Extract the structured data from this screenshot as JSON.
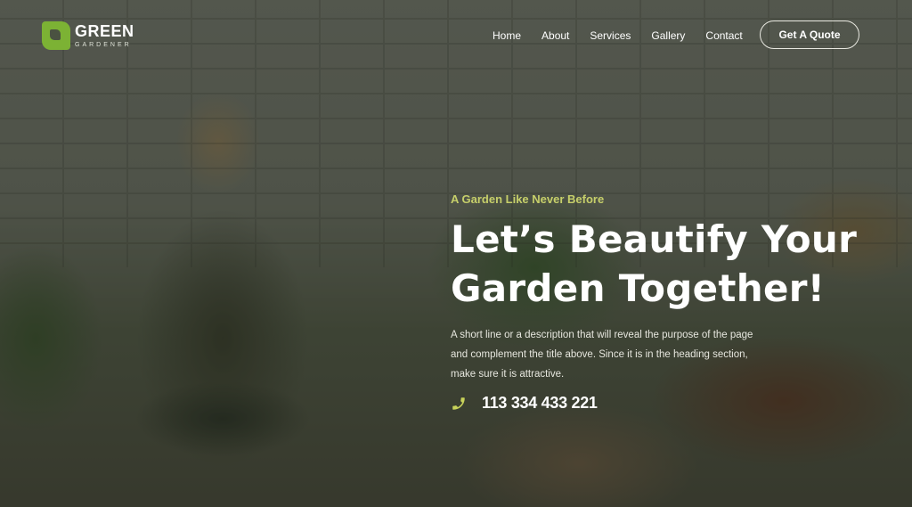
{
  "brand": {
    "name": "GREEN",
    "subtitle": "GARDENER",
    "logo_icon": "leaf-square-icon",
    "accent_color": "#7cb234"
  },
  "nav": {
    "items": [
      {
        "label": "Home"
      },
      {
        "label": "About"
      },
      {
        "label": "Services"
      },
      {
        "label": "Gallery"
      },
      {
        "label": "Contact"
      }
    ],
    "cta_label": "Get A Quote"
  },
  "hero": {
    "tagline": "A Garden Like Never Before",
    "tagline_color": "#c6cf6a",
    "headline_line1": "Let’s Beautify Your",
    "headline_line2": "Garden Together!",
    "description": "A short line or a description that will reveal the purpose of the page and complement the title above. Since it is in the heading section, make sure it is attractive.",
    "phone_icon": "phone-icon",
    "phone_number": "113 334 433 221",
    "background_image": "woman gardener sitting among potted plants against white brick wall"
  }
}
